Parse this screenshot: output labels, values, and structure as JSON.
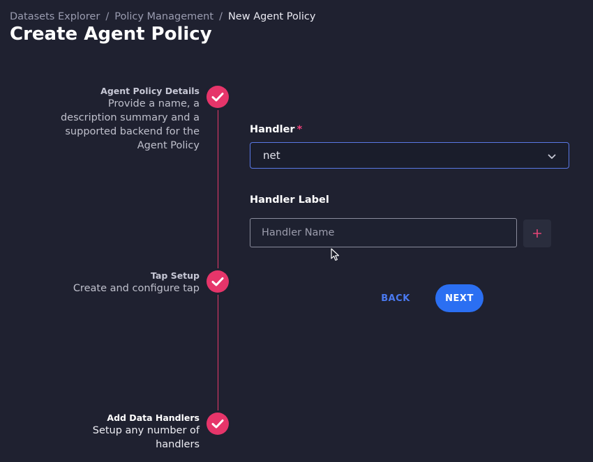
{
  "breadcrumb": {
    "items": [
      "Datasets Explorer",
      "Policy Management"
    ],
    "current": "New Agent Policy",
    "separator": "/"
  },
  "page": {
    "title": "Create Agent Policy"
  },
  "stepper": {
    "steps": [
      {
        "title": "Agent Policy Details",
        "description_lines": [
          "Provide a name, a",
          "description summary and a",
          "supported backend for the",
          "Agent Policy"
        ],
        "status": "complete"
      },
      {
        "title": "Tap Setup",
        "description_lines": [
          "Create and configure tap"
        ],
        "status": "complete"
      },
      {
        "title": "Add Data Handlers",
        "description_lines": [
          "Setup any number of",
          "handlers"
        ],
        "status": "complete-active"
      }
    ]
  },
  "form": {
    "handler": {
      "label": "Handler",
      "required_mark": "*",
      "value": "net"
    },
    "handler_label": {
      "label": "Handler Label",
      "placeholder": "Handler Name",
      "value": ""
    },
    "add_icon": "plus-icon",
    "back_label": "BACK",
    "next_label": "NEXT"
  },
  "colors": {
    "background": "#1f2130",
    "accent_pink": "#e6356a",
    "primary_blue": "#2b6ff2",
    "link_blue": "#4a79f0"
  }
}
